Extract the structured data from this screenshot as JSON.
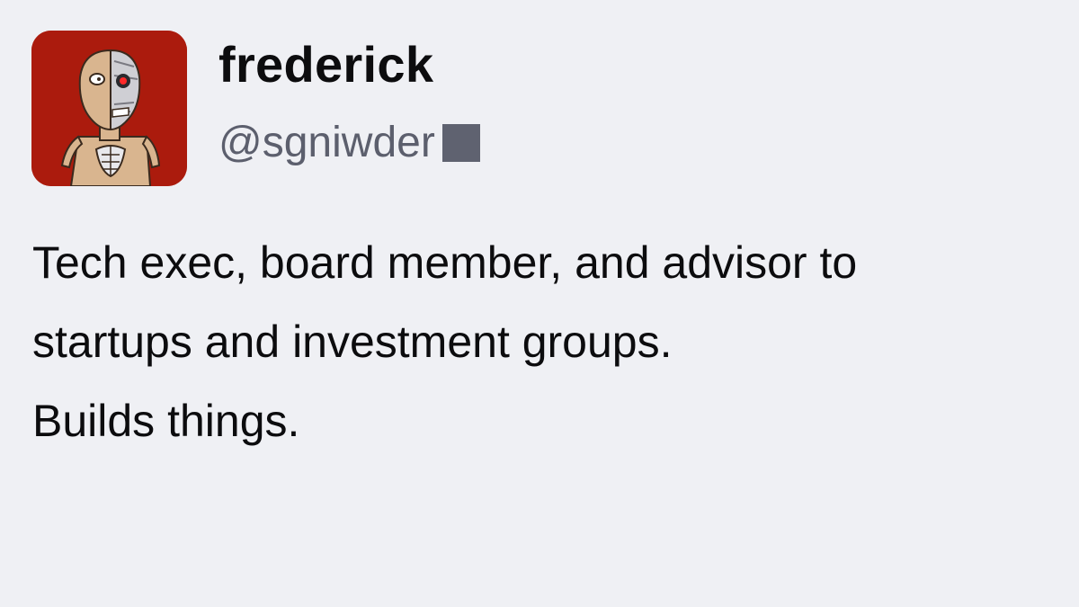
{
  "profile": {
    "display_name": "frederick",
    "handle": "@sgniwder",
    "avatar_icon": "cyborg-avatar-icon",
    "bio_lines": [
      "Tech exec, board member, and advisor to",
      "startups and investment groups.",
      "Builds things."
    ]
  },
  "colors": {
    "background": "#eff0f4",
    "avatar_background": "#ab1b0d",
    "name_text": "#0c0c0e",
    "handle_text": "#5c5f6d",
    "cursor_block": "#5f6270"
  }
}
